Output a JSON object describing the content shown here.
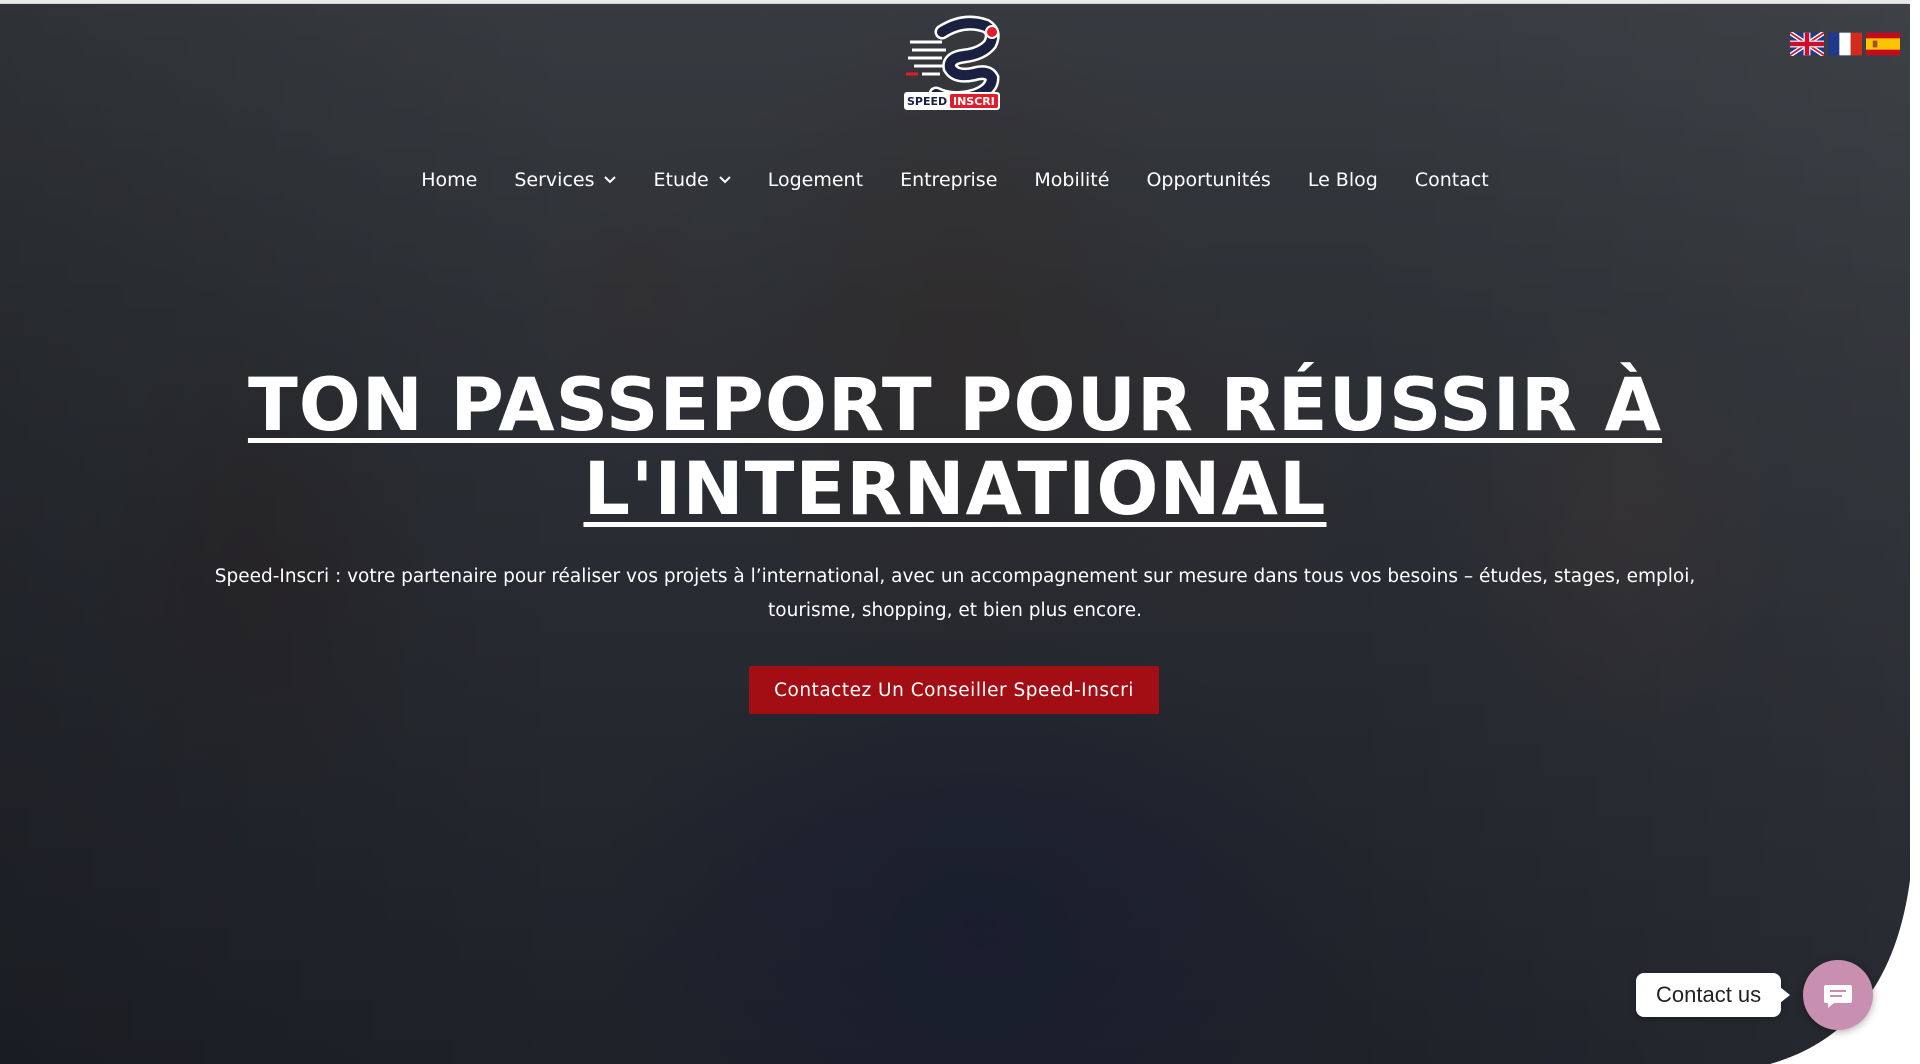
{
  "logo": {
    "text_top": "SPEED",
    "text_bottom": "INSCRI"
  },
  "languages": [
    {
      "code": "en",
      "icon": "uk-flag-icon"
    },
    {
      "code": "fr",
      "icon": "france-flag-icon"
    },
    {
      "code": "es",
      "icon": "spain-flag-icon"
    }
  ],
  "nav": {
    "items": [
      {
        "label": "Home"
      },
      {
        "label": "Services",
        "dropdown": true
      },
      {
        "label": "Etude",
        "dropdown": true
      },
      {
        "label": "Logement"
      },
      {
        "label": "Entreprise"
      },
      {
        "label": "Mobilité"
      },
      {
        "label": "Opportunités"
      },
      {
        "label": "Le Blog"
      },
      {
        "label": "Contact"
      }
    ]
  },
  "hero": {
    "headline_line1": "TON PASSEPORT POUR RÉUSSIR À",
    "headline_line2": "L'INTERNATIONAL",
    "subtitle": "Speed-Inscri : votre partenaire pour réaliser vos projets à l’international, avec un accompagnement sur mesure dans tous vos besoins – études, stages, emploi, tourisme, shopping, et bien plus encore.",
    "cta_label": "Contactez Un Conseiller Speed-Inscri"
  },
  "contact_widget": {
    "label": "Contact us",
    "icon": "chat-bubble-icon"
  },
  "colors": {
    "cta_bg": "#a30d14",
    "widget_bg": "#c98fb0",
    "logo_red": "#e21d2a",
    "logo_navy": "#1a2140"
  }
}
